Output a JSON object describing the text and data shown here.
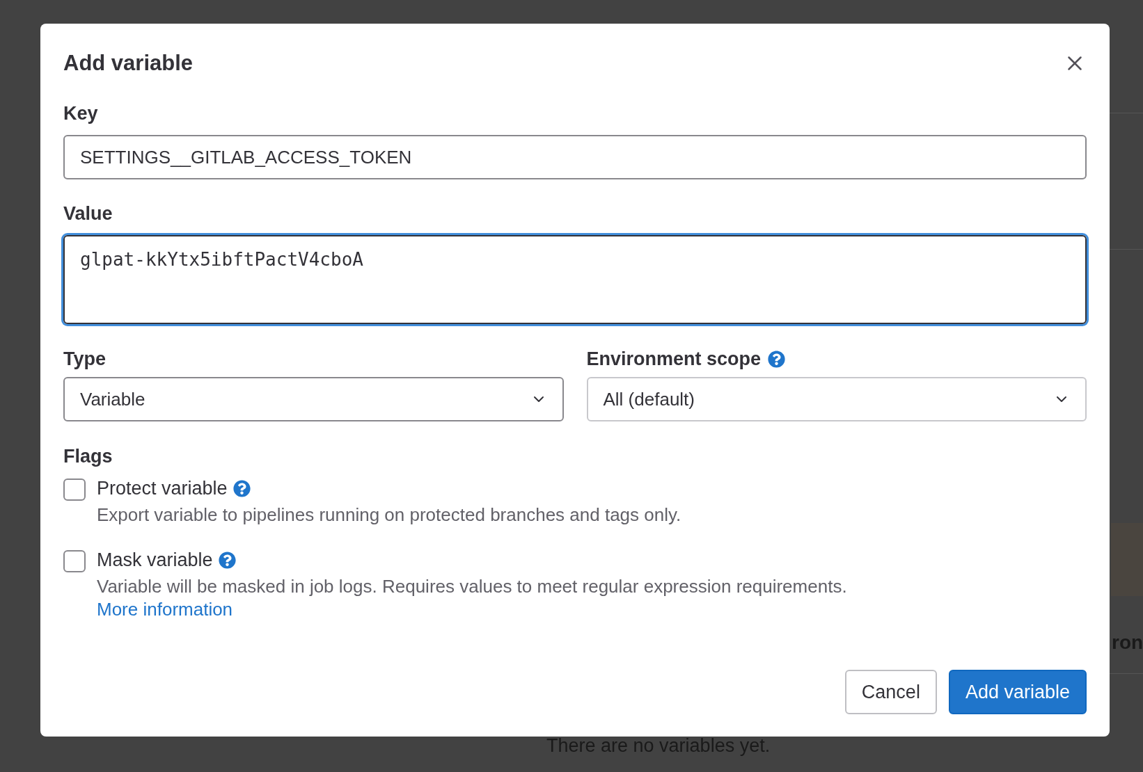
{
  "background": {
    "texts": [
      "ron",
      "There are no variables yet."
    ]
  },
  "modal": {
    "title": "Add variable",
    "fields": [
      {
        "kind": "text",
        "label": "Key",
        "value": "SETTINGS__GITLAB_ACCESS_TOKEN",
        "focused": false
      },
      {
        "kind": "textarea",
        "label": "Value",
        "value": "glpat-kkYtx5ibftPactV4cboA",
        "focused": true
      }
    ],
    "selects": [
      {
        "label": "Type",
        "value": "Variable",
        "help": false
      },
      {
        "label": "Environment scope",
        "value": "All (default)",
        "help": true
      }
    ],
    "flags_heading": "Flags",
    "flags": [
      {
        "label": "Protect variable",
        "checked": false,
        "description": "Export variable to pipelines running on protected branches and tags only."
      },
      {
        "label": "Mask variable",
        "checked": false,
        "description": "Variable will be masked in job logs. Requires values to meet regular expression requirements.",
        "link": "More information"
      }
    ],
    "buttons": [
      {
        "label": "Cancel",
        "kind": "secondary"
      },
      {
        "label": "Add variable",
        "kind": "primary"
      }
    ]
  }
}
